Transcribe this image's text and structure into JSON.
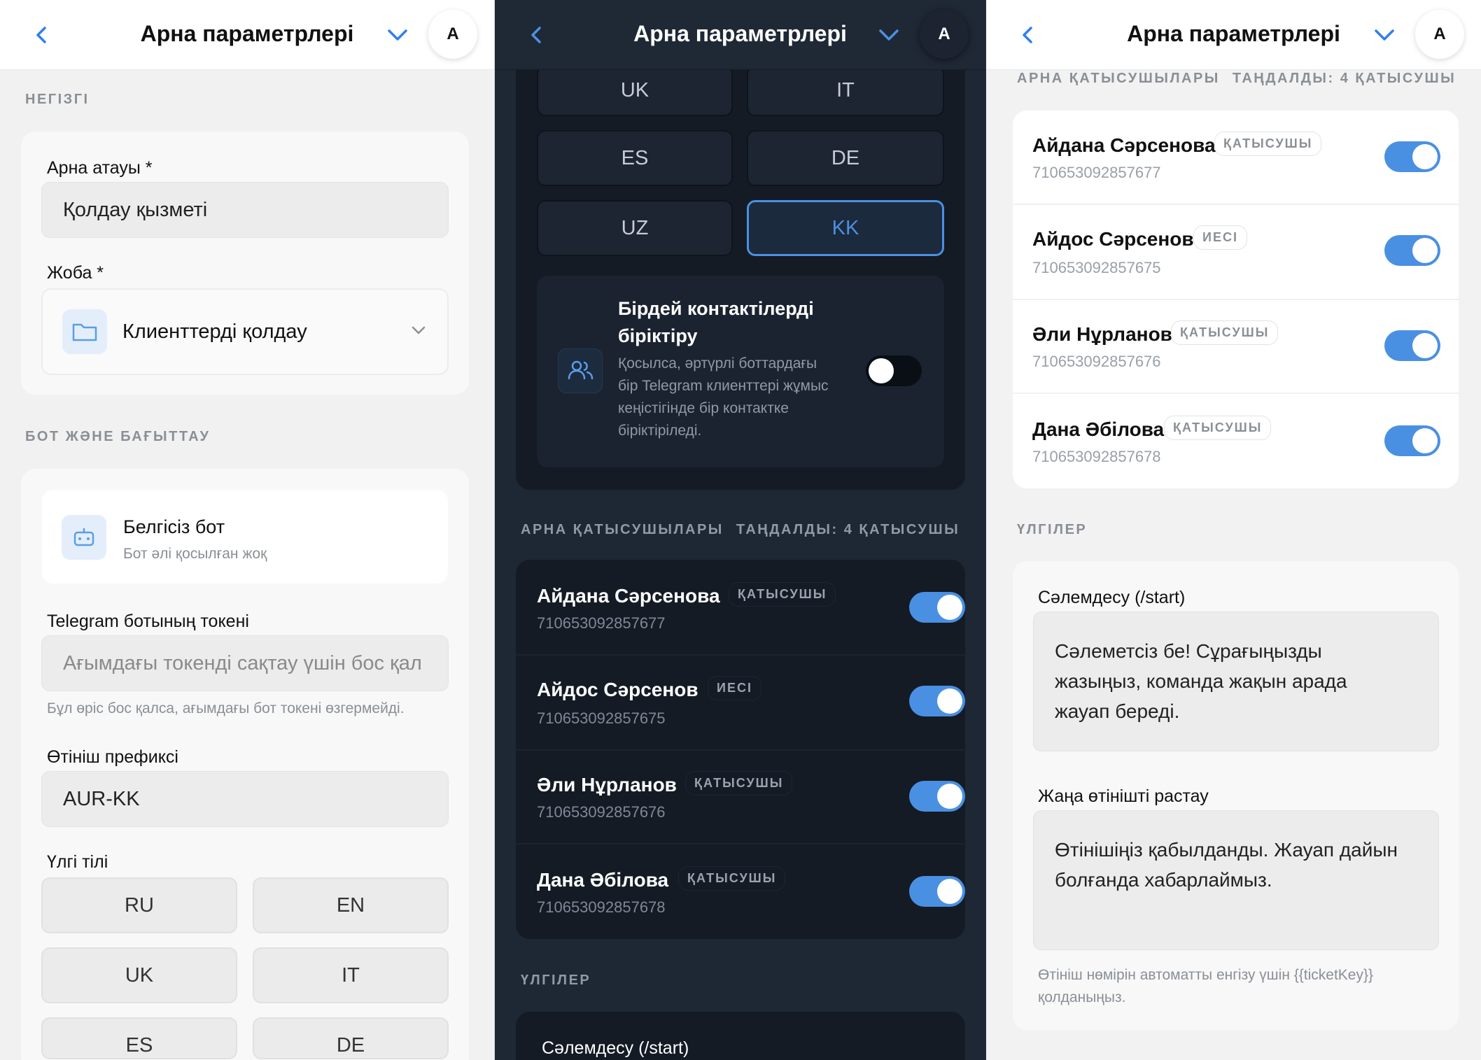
{
  "header": {
    "title": "Арна параметрлері",
    "avatar_letter": "A"
  },
  "basics": {
    "section_label": "НЕГІЗГІ",
    "channel_name_label": "Арна атауы *",
    "channel_name_value": "Қолдау қызметі",
    "project_label": "Жоба *",
    "project_value": "Клиенттерді қолдау"
  },
  "bot_routing": {
    "section_label": "БОТ ЖӘНЕ БАҒЫТТАУ",
    "bot_title": "Белгісіз бот",
    "bot_subtitle": "Бот әлі қосылған жоқ",
    "token_label": "Telegram ботының токені",
    "token_placeholder": "Ағымдағы токенді сақтау үшін бос қал",
    "token_hint": "Бұл өріс бос қалса, ағымдағы бот токені өзгермейді.",
    "prefix_label": "Өтініш префиксі",
    "prefix_value": "AUR-KK",
    "template_lang_label": "Үлгі тілі",
    "languages": [
      "RU",
      "EN",
      "UK",
      "IT",
      "ES",
      "DE",
      "UZ",
      "KK"
    ],
    "selected_language": "KK"
  },
  "merge_contacts": {
    "title_line1": "Бірдей контактілерді",
    "title_line2": "біріктіру",
    "desc_line1": "Қосылса, әртүрлі боттардағы",
    "desc_line2": "бір Telegram клиенттері жұмыс",
    "desc_line3": "кеңістігінде бір контактке",
    "desc_line4": "біріктіріледі.",
    "enabled": false
  },
  "members": {
    "section_label": "АРНА ҚАТЫСУШЫЛАРЫ",
    "selected_label": "ТАҢДАЛДЫ: 4 ҚАТЫСУШЫ",
    "items": [
      {
        "name": "Айдана Сәрсенова",
        "role": "ҚАТЫСУШЫ",
        "id": "710653092857677",
        "enabled": true
      },
      {
        "name": "Айдос Сәрсенов",
        "role": "ИЕСІ",
        "id": "710653092857675",
        "enabled": true
      },
      {
        "name": "Әли Нұрланов",
        "role": "ҚАТЫСУШЫ",
        "id": "710653092857676",
        "enabled": true
      },
      {
        "name": "Дана Әбілова",
        "role": "ҚАТЫСУШЫ",
        "id": "710653092857678",
        "enabled": true
      }
    ]
  },
  "templates": {
    "section_label": "ҮЛГІЛЕР",
    "greeting_label": "Сәлемдесу (/start)",
    "greeting_line1": "Сәлеметсіз бе! Сұрағыңызды",
    "greeting_line2": "жазыңыз, команда жақын арада",
    "greeting_line3": "жауап береді.",
    "confirm_label": "Жаңа өтінішті растау",
    "confirm_line1": "Өтінішіңіз қабылданды. Жауап дайын",
    "confirm_line2": "болғанда хабарлаймыз.",
    "hint_line1": "Өтініш нөмірін автоматты енгізу үшін {{ticketKey}}",
    "hint_line2": "қолданыңыз."
  },
  "colors": {
    "accent": "#4a90e2",
    "dark_bg": "#1e2734",
    "light_bg": "#f1f1f1"
  }
}
